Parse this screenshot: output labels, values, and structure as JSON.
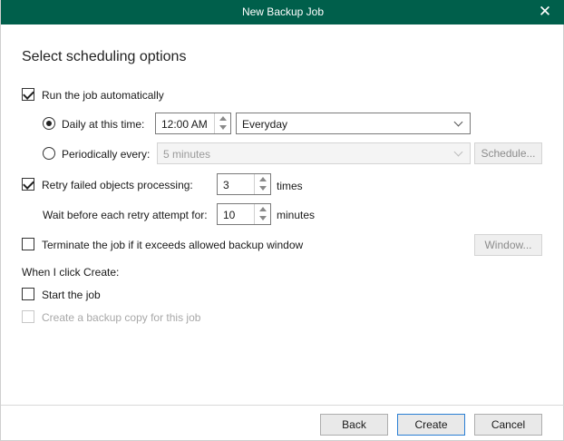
{
  "window": {
    "title": "New Backup Job"
  },
  "heading": "Select scheduling options",
  "run_auto": {
    "label": "Run the job automatically",
    "checked": true
  },
  "daily": {
    "label": "Daily at this time:",
    "time": "12:00 AM",
    "day_option": "Everyday"
  },
  "periodically": {
    "label": "Periodically every:",
    "value": "5 minutes",
    "schedule_button": "Schedule..."
  },
  "retry": {
    "label": "Retry failed objects processing:",
    "count": "3",
    "count_unit": "times",
    "wait_label": "Wait before each retry attempt for:",
    "wait": "10",
    "wait_unit": "minutes",
    "checked": true
  },
  "terminate": {
    "label": "Terminate the job if it exceeds allowed backup window",
    "window_button": "Window...",
    "checked": false
  },
  "on_create": {
    "label": "When I click Create:",
    "start_job": "Start the job",
    "backup_copy": "Create a backup copy for this job"
  },
  "footer": {
    "back": "Back",
    "create": "Create",
    "cancel": "Cancel"
  },
  "colors": {
    "titlebar": "#005f4b",
    "accent_border": "#2a7fd4"
  }
}
